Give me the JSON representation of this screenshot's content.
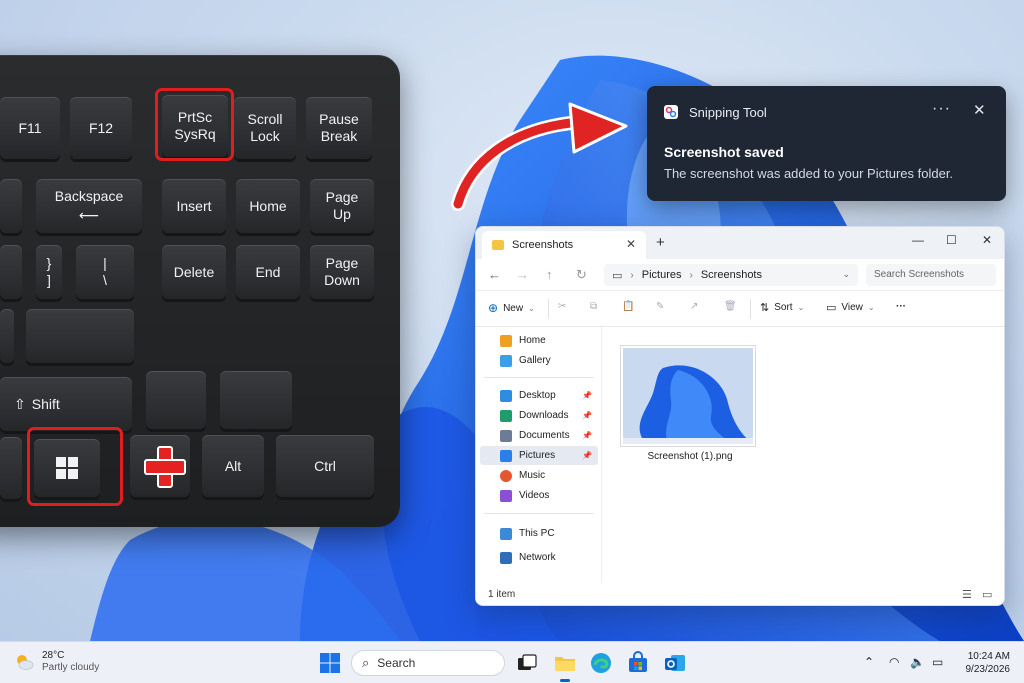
{
  "keyboard": {
    "keys": {
      "f11": "F11",
      "f12": "F12",
      "prtsc": "PrtSc\nSysRq",
      "scroll": "Scroll\nLock",
      "pause": "Pause\nBreak",
      "backspace": "Backspace",
      "insert": "Insert",
      "home": "Home",
      "pageup": "Page\nUp",
      "brace": "}\n]",
      "pipe": "|\n\\",
      "delete": "Delete",
      "end": "End",
      "pagedown": "Page\nDown",
      "shift": "Shift",
      "alt": "Alt",
      "ctrl": "Ctrl"
    },
    "highlighted_keys": [
      "PrtSc",
      "Windows"
    ],
    "highlight_color": "#e01e1e"
  },
  "toast": {
    "app_name": "Snipping Tool",
    "more_label": "···",
    "close_label": "✕",
    "title": "Screenshot saved",
    "body": "The screenshot was added to your Pictures folder."
  },
  "explorer": {
    "tab_title": "Screenshots",
    "tab_close": "✕",
    "new_tab": "+",
    "window_controls": {
      "minimize": "—",
      "maximize": "☐",
      "close": "✕"
    },
    "breadcrumb": [
      "Pictures",
      "Screenshots"
    ],
    "search_placeholder": "Search Screenshots",
    "toolbar": {
      "new": "New",
      "sort": "Sort",
      "view": "View",
      "more": "···"
    },
    "sidebar": {
      "home": "Home",
      "gallery": "Gallery",
      "desktop": "Desktop",
      "downloads": "Downloads",
      "documents": "Documents",
      "pictures": "Pictures",
      "music": "Music",
      "videos": "Videos",
      "this_pc": "This PC",
      "network": "Network"
    },
    "selected_item": "Pictures",
    "file": {
      "name": "Screenshot (1).png"
    },
    "status": "1 item"
  },
  "taskbar": {
    "weather_temp": "28°C",
    "weather_desc": "Partly cloudy",
    "search_label": "Search",
    "time": "10:24 AM",
    "date": "9/23/2026",
    "pinned_icons": [
      "windows-start-icon",
      "task-view-icon",
      "file-explorer-icon",
      "edge-icon",
      "store-icon",
      "outlook-icon"
    ]
  },
  "colors": {
    "toast_bg": "#1f2734",
    "accent": "#0067c0",
    "wallpaper_blue": "#1a5fe0"
  }
}
